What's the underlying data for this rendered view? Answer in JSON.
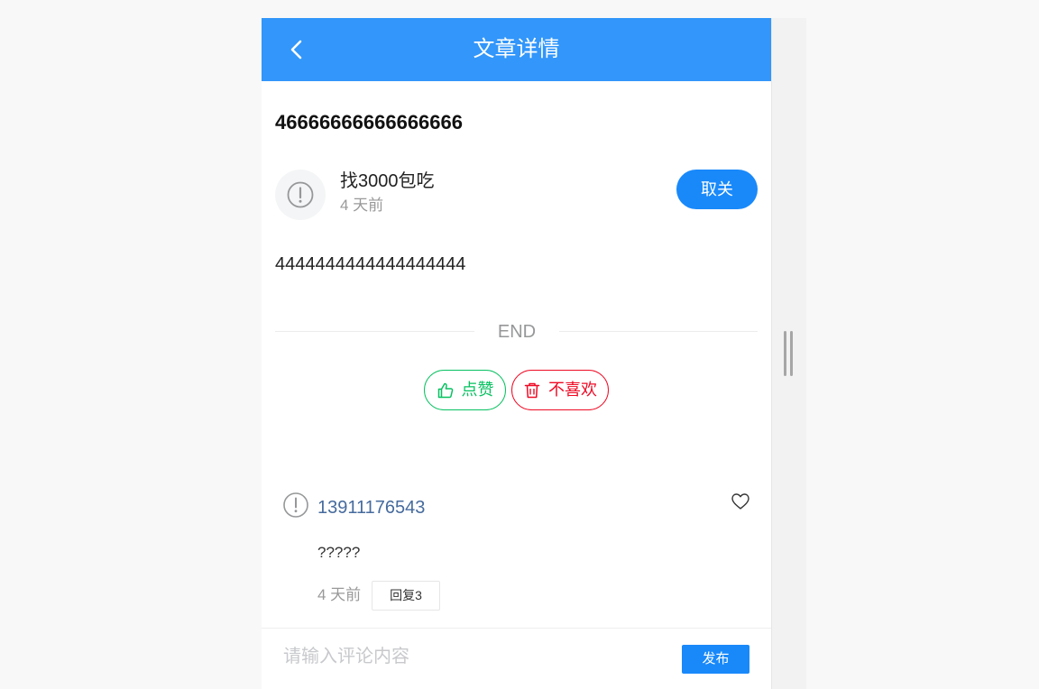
{
  "navbar": {
    "title": "文章详情",
    "back_icon": "chevron-left-icon"
  },
  "article": {
    "title": "46666666666666666",
    "content": "4444444444444444444",
    "end_label": "END"
  },
  "author": {
    "name": "找3000包吃",
    "time": "4 天前",
    "avatar_icon": "info-circle-icon",
    "follow_label": "取关"
  },
  "actions": {
    "like_label": "点赞",
    "like_icon": "thumbs-up-icon",
    "like_color": "#07c160",
    "dislike_label": "不喜欢",
    "dislike_icon": "trash-icon",
    "dislike_color": "#ee0a24"
  },
  "comments": [
    {
      "user": "13911176543",
      "text": "?????",
      "time": "4 天前",
      "reply_label": "回复3",
      "avatar_icon": "info-circle-icon",
      "like_icon": "heart-outline-icon"
    }
  ],
  "comment_bar": {
    "placeholder": "请输入评论内容",
    "value": "",
    "publish_label": "发布"
  },
  "colors": {
    "navbar_bg": "#3296fa",
    "primary": "#1989fa",
    "comment_user": "#466b9d"
  }
}
